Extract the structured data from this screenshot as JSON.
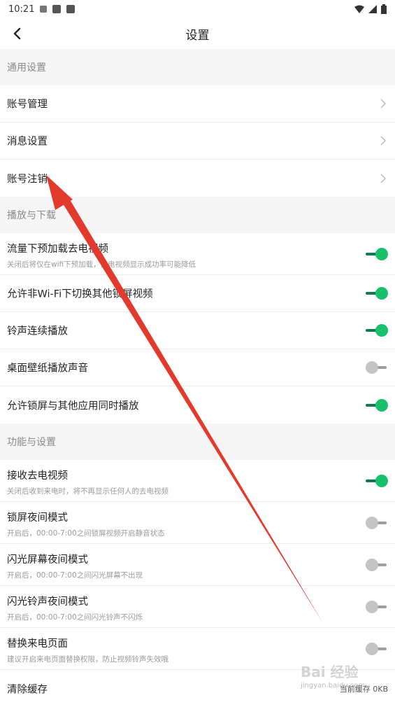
{
  "status_bar": {
    "time": "10:21",
    "battery": "battery-icon",
    "wifi": "wifi-icon",
    "signal": "signal-icon"
  },
  "header": {
    "title": "设置"
  },
  "sections": {
    "general": {
      "title": "通用设置",
      "items": [
        {
          "label": "账号管理"
        },
        {
          "label": "消息设置"
        },
        {
          "label": "账号注销"
        }
      ]
    },
    "playback": {
      "title": "播放与下载",
      "items": [
        {
          "label": "流量下预加载去电视频",
          "sub": "关闭后将仅在wifi下预加载，去电视频显示成功率可能降低",
          "on": true
        },
        {
          "label": "允许非Wi-Fi下切换其他锁屏视频",
          "on": true
        },
        {
          "label": "铃声连续播放",
          "on": true
        },
        {
          "label": "桌面壁纸播放声音",
          "on": false
        },
        {
          "label": "允许锁屏与其他应用同时播放",
          "on": true
        }
      ]
    },
    "features": {
      "title": "功能与设置",
      "items": [
        {
          "label": "接收去电视频",
          "sub": "关闭后收到来电时，将不再显示任何人的去电视频",
          "on": true
        },
        {
          "label": "锁屏夜间模式",
          "sub": "开启后，00:00-7:00之间锁屏视频开启静音状态",
          "on": false
        },
        {
          "label": "闪光屏幕夜间模式",
          "sub": "开启后，00:00-7:00之间闪光屏幕不出现",
          "on": false
        },
        {
          "label": "闪光铃声夜间模式",
          "sub": "开启后，00:00-7:00之间闪光铃声不闪烁",
          "on": false
        },
        {
          "label": "替换来电页面",
          "sub": "建议开启来电页面替换权限，防止视频铃声失效哦",
          "on": false
        },
        {
          "label": "清除缓存",
          "value": "当前缓存 0KB"
        }
      ]
    }
  },
  "watermark": {
    "text": "Bai 经验",
    "sub": "jingyan.baidu.com"
  },
  "colors": {
    "toggle_on": "#19c06c",
    "toggle_off": "#c4c4c4",
    "annotation_arrow": "#e23b2e"
  }
}
